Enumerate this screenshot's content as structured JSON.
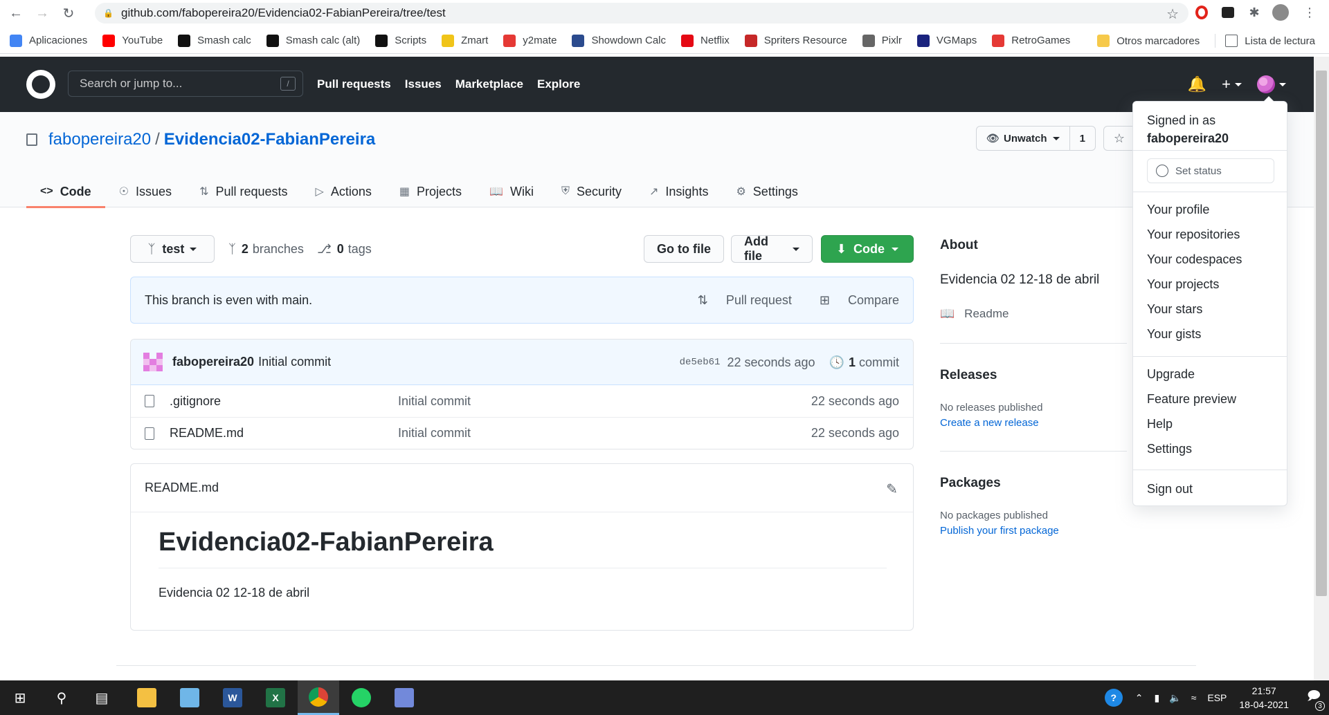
{
  "browser": {
    "url": "github.com/fabopereira20/Evidencia02-FabianPereira/tree/test",
    "bookmarks": [
      {
        "label": "Aplicaciones",
        "color": "#4285f4"
      },
      {
        "label": "YouTube",
        "color": "#ff0000"
      },
      {
        "label": "Smash calc",
        "color": "#111111"
      },
      {
        "label": "Smash calc (alt)",
        "color": "#111111"
      },
      {
        "label": "Scripts",
        "color": "#111111"
      },
      {
        "label": "Zmart",
        "color": "#f0c419"
      },
      {
        "label": "y2mate",
        "color": "#e53935"
      },
      {
        "label": "Showdown Calc",
        "color": "#2b4b8e"
      },
      {
        "label": "Netflix",
        "color": "#e50914"
      },
      {
        "label": "Spriters Resource",
        "color": "#c62828"
      },
      {
        "label": "Pixlr",
        "color": "#666666"
      },
      {
        "label": "VGMaps",
        "color": "#1a237e"
      },
      {
        "label": "RetroGames",
        "color": "#e53935"
      }
    ],
    "other_bookmarks": "Otros marcadores",
    "reading_list": "Lista de lectura"
  },
  "header": {
    "search_placeholder": "Search or jump to...",
    "search_key": "/",
    "nav": [
      "Pull requests",
      "Issues",
      "Marketplace",
      "Explore"
    ]
  },
  "repo": {
    "owner": "fabopereira20",
    "separator": "/",
    "name": "Evidencia02-FabianPereira",
    "watch_label": "Unwatch",
    "watch_count": "1",
    "tabs": [
      {
        "label": "Code",
        "icon": "code-icon"
      },
      {
        "label": "Issues",
        "icon": "issue-icon"
      },
      {
        "label": "Pull requests",
        "icon": "pull-request-icon"
      },
      {
        "label": "Actions",
        "icon": "play-icon"
      },
      {
        "label": "Projects",
        "icon": "project-icon"
      },
      {
        "label": "Wiki",
        "icon": "book-icon"
      },
      {
        "label": "Security",
        "icon": "shield-icon"
      },
      {
        "label": "Insights",
        "icon": "graph-icon"
      },
      {
        "label": "Settings",
        "icon": "gear-icon"
      }
    ]
  },
  "toolbar": {
    "branch": "test",
    "branches_count": "2",
    "branches_label": "branches",
    "tags_count": "0",
    "tags_label": "tags",
    "go_to_file": "Go to file",
    "add_file": "Add file",
    "code": "Code"
  },
  "flash": {
    "message": "This branch is even with main.",
    "pull_request": "Pull request",
    "compare": "Compare"
  },
  "commit": {
    "author": "fabopereira20",
    "message": "Initial commit",
    "sha": "de5eb61",
    "age": "22 seconds ago",
    "count": "1",
    "count_label": "commit"
  },
  "files": [
    {
      "name": ".gitignore",
      "message": "Initial commit",
      "age": "22 seconds ago"
    },
    {
      "name": "README.md",
      "message": "Initial commit",
      "age": "22 seconds ago"
    }
  ],
  "readme": {
    "filename": "README.md",
    "heading": "Evidencia02-FabianPereira",
    "body": "Evidencia 02 12-18 de abril"
  },
  "sidebar": {
    "about_title": "About",
    "about_desc": "Evidencia 02 12-18 de abril",
    "readme_link": "Readme",
    "releases_title": "Releases",
    "releases_none": "No releases published",
    "releases_link": "Create a new release",
    "packages_title": "Packages",
    "packages_none": "No packages published",
    "packages_link": "Publish your first package"
  },
  "dropdown": {
    "signed_in_as": "Signed in as",
    "username": "fabopereira20",
    "set_status": "Set status",
    "group1": [
      "Your profile",
      "Your repositories",
      "Your codespaces",
      "Your projects",
      "Your stars",
      "Your gists"
    ],
    "group2": [
      "Upgrade",
      "Feature preview",
      "Help",
      "Settings"
    ],
    "sign_out": "Sign out"
  },
  "taskbar": {
    "language": "ESP",
    "time": "21:57",
    "date": "18-04-2021",
    "notifications": "3"
  },
  "colors": {
    "header_bg": "#24292e",
    "link": "#0366d6",
    "code_button": "#2ea44f",
    "tab_underline": "#f9826c"
  }
}
